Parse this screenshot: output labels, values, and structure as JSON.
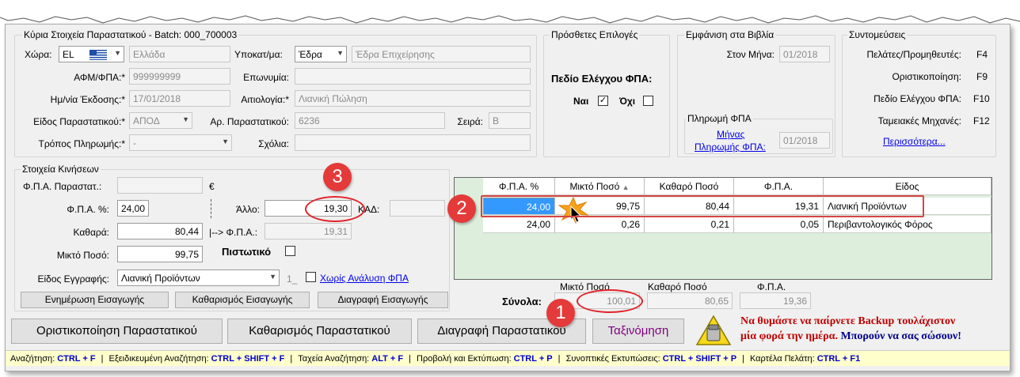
{
  "main": {
    "title": "Κύρια Στοιχεία Παραστατικού - Batch: 000_700003",
    "country_label": "Χώρα:",
    "country_code": "EL",
    "country_name": "Ελλάδα",
    "branch_label": "Υποκατ/μα:",
    "branch_value": "Έδρα",
    "branch_desc": "Έδρα Επιχείρησης",
    "afm_label": "ΑΦΜ/ΦΠΑ:*",
    "afm_value": "999999999",
    "name_label": "Επωνυμία:",
    "name_value": "",
    "date_label": "Ημ/νία Έκδοσης:*",
    "date_value": "17/01/2018",
    "reason_label": "Αιτιολογία:*",
    "reason_value": "Λιανική Πώληση",
    "doctype_label": "Είδος Παραστατικού:*",
    "doctype_value": "ΑΠΟΔ",
    "docno_label": "Αρ. Παραστατικού:",
    "docno_value": "6236",
    "series_label": "Σειρά:",
    "series_value": "Β",
    "payment_label": "Τρόπος Πληρωμής:*",
    "payment_value": "-",
    "comments_label": "Σχόλια:",
    "comments_value": ""
  },
  "extra": {
    "title": "Πρόσθετες Επιλογές",
    "vat_check_label": "Πεδίο Ελέγχου ΦΠΑ:",
    "yes_label": "Ναι",
    "no_label": "Όχι"
  },
  "books": {
    "title": "Εμφάνιση στα Βιβλία",
    "month_label": "Στον Μήνα:",
    "month_value": "01/2018",
    "vatpay_title": "Πληρωμή ΦΠΑ",
    "vatpay_link_1": "Μήνας",
    "vatpay_link_2": "Πληρωμής ΦΠΑ:",
    "vatpay_value": "01/2018"
  },
  "shortcuts": {
    "title": "Συντομεύσεις",
    "items": [
      {
        "label": "Πελάτες/Προμηθευτές:",
        "key": "F4"
      },
      {
        "label": "Οριστικοποίηση:",
        "key": "F9"
      },
      {
        "label": "Πεδίο Ελέγχου ΦΠΑ:",
        "key": "F10"
      },
      {
        "label": "Ταμειακές Μηχανές:",
        "key": "F12"
      }
    ],
    "more": "Περισσότερα..."
  },
  "movements": {
    "title": "Στοιχεία Κινήσεων",
    "vat_doc_label": "Φ.Π.Α. Παραστατ.:",
    "vat_doc_value": "",
    "euro": "€",
    "vat_pct_label": "Φ.Π.Α. %:",
    "vat_pct_value": "24,00",
    "net_label": "Καθαρά:",
    "net_value": "80,44",
    "gross_label": "Μικτό Ποσό:",
    "gross_value": "99,75",
    "other_label": "Άλλο:",
    "other_value": "19,30",
    "kad_label": "ΚΑΔ:",
    "kad_value": "",
    "arrow_vat_label": "|--> Φ.Π.Α.:",
    "arrow_vat_value": "19,31",
    "credit_label": "Πιστωτικό",
    "entry_type_label": "Είδος Εγγραφής:",
    "entry_type_value": "Λιανική Προϊόντων",
    "entry_type_small": "1_",
    "no_vat_link": "Χωρίς Ανάλυση ΦΠΑ",
    "btn_update": "Ενημέρωση Εισαγωγής",
    "btn_clear": "Καθαρισμός Εισαγωγής",
    "btn_delete": "Διαγραφή Εισαγωγής"
  },
  "grid": {
    "columns": [
      "Φ.Π.Α. %",
      "Μικτό Ποσό",
      "Καθαρό Ποσό",
      "Φ.Π.Α.",
      "Είδος"
    ],
    "rows": [
      [
        "24,00",
        "99,75",
        "80,44",
        "19,31",
        "Λιανική Προϊόντων"
      ],
      [
        "24,00",
        "0,26",
        "0,21",
        "0,05",
        "Περιβαντολογικός Φόρος"
      ]
    ]
  },
  "totals": {
    "label": "Σύνολα:",
    "gross_label": "Μικτό Ποσό",
    "gross_value": "100,01",
    "net_label": "Καθαρό Ποσό",
    "net_value": "80,65",
    "vat_label": "Φ.Π.Α.",
    "vat_value": "19,36"
  },
  "actions": {
    "finalize": "Οριστικοποίηση Παραστατικού",
    "clear": "Καθαρισμός Παραστατικού",
    "delete": "Διαγραφή Παραστατικού",
    "sort": "Ταξινόμηση"
  },
  "backup": {
    "line1": "Να θυμάστε να παίρνετε Backup τουλάχιστον",
    "line2a": "μία φορά την ημέρα.",
    "line2b": "Μπορούν να σας σώσουν!"
  },
  "annotations": {
    "m1": "1",
    "m2": "2",
    "m3": "3"
  },
  "statusbar": [
    {
      "label": "Αναζήτηση:",
      "key": "CTRL + F"
    },
    {
      "label": "Εξειδικευμένη Αναζήτηση:",
      "key": "CTRL + SHIFT + F"
    },
    {
      "label": "Ταχεία Αναζήτηση:",
      "key": "ALT + F"
    },
    {
      "label": "Προβολή και Εκτύπωση:",
      "key": "CTRL + P"
    },
    {
      "label": "Συνοπτικές Εκτυπώσεις:",
      "key": "CTRL + SHIFT + P"
    },
    {
      "label": "Καρτέλα Πελάτη:",
      "key": "CTRL + F1"
    }
  ],
  "colors": {
    "annotation_red": "#e43a3a",
    "grid_bg": "#ddeedd",
    "selected_cell": "#3399ff",
    "sort_button_text": "#800080",
    "status_bg": "#ffffcc",
    "shortcut_key": "#0000cc"
  }
}
